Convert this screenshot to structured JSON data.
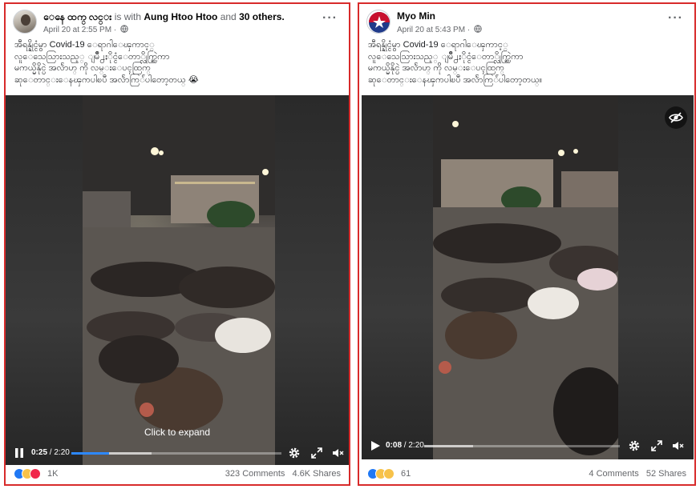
{
  "left_post": {
    "author": "ေနေ ထက္ လင္း",
    "is_with_text": "is with",
    "tagged": "Aung Htoo Htoo",
    "and_text": "and",
    "others": "30 others.",
    "timestamp": "April 20 at 2:55 PM",
    "caption_lines": [
      "အီရန္နိုင္ငံမွာ Covid-19 ေရာဂါေၾကာင့္",
      "လူေသေသြားသည့္ ျမိဳ႕ႏိုင္ငံေတာ္လိုက္ဆြဲကာ",
      "မကယ္မိနိုင္ပဲ အလႅာဟ္ ကို လမ္းေပၚထြက္",
      "ဆုေတာင္းေနၾကပါၿပီ အလႅာကြ်ံပါတော့တယ္ 😭"
    ],
    "video": {
      "overlay_text": "Click to expand",
      "current_time": "0:25",
      "duration": "/ 2:20",
      "progress": 0.18,
      "buffered": 0.38
    },
    "reaction_count": "1K",
    "comments": "323 Comments",
    "shares": "4.6K Shares"
  },
  "right_post": {
    "author": "Myo Min",
    "timestamp": "April 20 at 5:43 PM",
    "caption_lines": [
      "အီရန္နိုင္ငံမွာ Covid-19 ေရာဂါေၾကာင့္",
      "လူေသေသြားသည့္ ျမိဳ႕ႏိုင္ငံေတာ္လိုက္ဆြဲကာ",
      "မကယ္မိနိုင္ပဲ အလႅာဟ္ ကို လမ္းေပၚထြက္",
      "ဆုေတာင္းေနၾကပါၿပီ အလႅာကြ်ံပါတော့တယ္။"
    ],
    "video": {
      "current_time": "0:08",
      "duration": "/ 2:20",
      "progress": 0.0,
      "buffered": 0.25
    },
    "reaction_count": "61",
    "comments": "4 Comments",
    "shares": "52 Shares"
  },
  "colors": {
    "highlight_border": "#d82b2b",
    "progress_blue": "#2d88ff",
    "like_blue": "#2078f4",
    "haha_yellow": "#f7c24a",
    "love_red": "#f0284a"
  },
  "icons": [
    "globe-icon",
    "more-icon",
    "pause-icon",
    "play-icon",
    "settings-icon",
    "fullscreen-icon",
    "mute-icon",
    "hide-icon"
  ]
}
